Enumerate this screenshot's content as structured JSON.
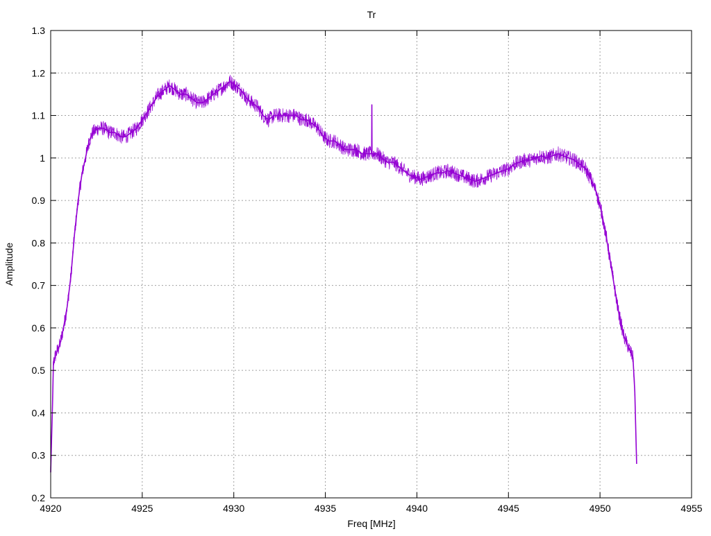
{
  "chart_data": {
    "type": "line",
    "title": "Tr",
    "xlabel": "Freq [MHz]",
    "ylabel": "Amplitude",
    "xlim": [
      4920,
      4955
    ],
    "ylim": [
      0.2,
      1.3
    ],
    "xticks": [
      4920,
      4925,
      4930,
      4935,
      4940,
      4945,
      4950,
      4955
    ],
    "yticks": [
      0.2,
      0.3,
      0.4,
      0.5,
      0.6,
      0.7,
      0.8,
      0.9,
      1,
      1.1,
      1.2,
      1.3
    ],
    "xtick_labels": [
      "4920",
      "4925",
      "4930",
      "4935",
      "4940",
      "4945",
      "4950",
      "4955"
    ],
    "ytick_labels": [
      "0.2",
      "0.3",
      "0.4",
      "0.5",
      "0.6",
      "0.7",
      "0.8",
      "0.9",
      "1",
      "1.1",
      "1.2",
      "1.3"
    ],
    "grid": true,
    "legend": "none",
    "series": [
      {
        "color": "#9400d3",
        "points": [
          [
            4920.0,
            0.26
          ],
          [
            4920.1,
            0.42
          ],
          [
            4920.15,
            0.52
          ],
          [
            4920.3,
            0.54
          ],
          [
            4920.5,
            0.56
          ],
          [
            4920.7,
            0.6
          ],
          [
            4920.9,
            0.65
          ],
          [
            4921.1,
            0.72
          ],
          [
            4921.3,
            0.82
          ],
          [
            4921.5,
            0.9
          ],
          [
            4921.7,
            0.96
          ],
          [
            4921.9,
            1.0
          ],
          [
            4922.1,
            1.04
          ],
          [
            4922.3,
            1.06
          ],
          [
            4922.6,
            1.07
          ],
          [
            4922.9,
            1.07
          ],
          [
            4923.2,
            1.06
          ],
          [
            4923.5,
            1.06
          ],
          [
            4923.8,
            1.05
          ],
          [
            4924.1,
            1.05
          ],
          [
            4924.4,
            1.06
          ],
          [
            4924.7,
            1.07
          ],
          [
            4925.0,
            1.09
          ],
          [
            4925.3,
            1.11
          ],
          [
            4925.6,
            1.13
          ],
          [
            4925.9,
            1.15
          ],
          [
            4926.2,
            1.16
          ],
          [
            4926.5,
            1.17
          ],
          [
            4926.8,
            1.16
          ],
          [
            4927.1,
            1.15
          ],
          [
            4927.4,
            1.15
          ],
          [
            4927.7,
            1.14
          ],
          [
            4928.0,
            1.13
          ],
          [
            4928.3,
            1.13
          ],
          [
            4928.6,
            1.14
          ],
          [
            4928.9,
            1.15
          ],
          [
            4929.2,
            1.16
          ],
          [
            4929.5,
            1.17
          ],
          [
            4929.8,
            1.18
          ],
          [
            4930.1,
            1.17
          ],
          [
            4930.4,
            1.16
          ],
          [
            4930.7,
            1.14
          ],
          [
            4931.0,
            1.13
          ],
          [
            4931.3,
            1.12
          ],
          [
            4931.6,
            1.1
          ],
          [
            4931.9,
            1.09
          ],
          [
            4932.2,
            1.1
          ],
          [
            4932.5,
            1.1
          ],
          [
            4932.8,
            1.1
          ],
          [
            4933.1,
            1.1
          ],
          [
            4933.4,
            1.1
          ],
          [
            4933.7,
            1.09
          ],
          [
            4934.0,
            1.09
          ],
          [
            4934.3,
            1.08
          ],
          [
            4934.6,
            1.07
          ],
          [
            4934.9,
            1.05
          ],
          [
            4935.2,
            1.04
          ],
          [
            4935.5,
            1.04
          ],
          [
            4935.8,
            1.03
          ],
          [
            4936.1,
            1.02
          ],
          [
            4936.4,
            1.02
          ],
          [
            4936.7,
            1.02
          ],
          [
            4937.0,
            1.01
          ],
          [
            4937.3,
            1.01
          ],
          [
            4937.53,
            1.01
          ],
          [
            4937.54,
            1.125
          ],
          [
            4937.55,
            1.01
          ],
          [
            4937.8,
            1.01
          ],
          [
            4938.1,
            1.0
          ],
          [
            4938.4,
            0.99
          ],
          [
            4938.7,
            0.99
          ],
          [
            4939.0,
            0.98
          ],
          [
            4939.3,
            0.97
          ],
          [
            4939.6,
            0.96
          ],
          [
            4939.9,
            0.955
          ],
          [
            4940.2,
            0.95
          ],
          [
            4940.5,
            0.955
          ],
          [
            4940.8,
            0.96
          ],
          [
            4941.1,
            0.965
          ],
          [
            4941.4,
            0.965
          ],
          [
            4941.7,
            0.97
          ],
          [
            4942.0,
            0.965
          ],
          [
            4942.3,
            0.96
          ],
          [
            4942.6,
            0.955
          ],
          [
            4942.9,
            0.95
          ],
          [
            4943.2,
            0.945
          ],
          [
            4943.5,
            0.95
          ],
          [
            4943.8,
            0.955
          ],
          [
            4944.1,
            0.96
          ],
          [
            4944.4,
            0.965
          ],
          [
            4944.7,
            0.97
          ],
          [
            4945.0,
            0.975
          ],
          [
            4945.3,
            0.985
          ],
          [
            4945.6,
            0.99
          ],
          [
            4945.9,
            0.995
          ],
          [
            4946.2,
            0.995
          ],
          [
            4946.5,
            1.0
          ],
          [
            4946.8,
            1.005
          ],
          [
            4947.1,
            1.0
          ],
          [
            4947.4,
            1.005
          ],
          [
            4947.7,
            1.01
          ],
          [
            4948.0,
            1.005
          ],
          [
            4948.3,
            1.0
          ],
          [
            4948.6,
            0.995
          ],
          [
            4948.9,
            0.985
          ],
          [
            4949.2,
            0.975
          ],
          [
            4949.5,
            0.95
          ],
          [
            4949.8,
            0.92
          ],
          [
            4950.1,
            0.87
          ],
          [
            4950.4,
            0.8
          ],
          [
            4950.7,
            0.72
          ],
          [
            4951.0,
            0.64
          ],
          [
            4951.3,
            0.58
          ],
          [
            4951.6,
            0.55
          ],
          [
            4951.8,
            0.53
          ],
          [
            4951.9,
            0.45
          ],
          [
            4952.0,
            0.28
          ]
        ]
      }
    ]
  }
}
